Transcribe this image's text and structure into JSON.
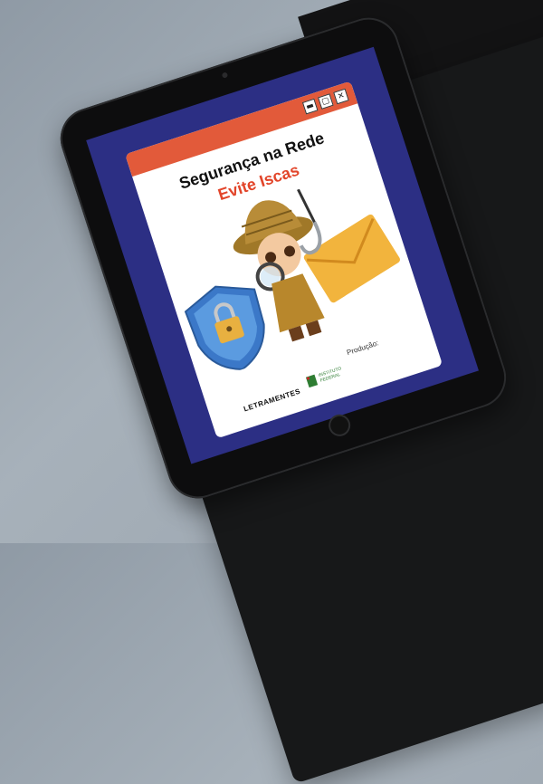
{
  "ebook": {
    "title_line1": "Segurança na Rede",
    "title_line2": "Evite Iscas",
    "production_label": "Produção:",
    "publisher": "LETRAMENTES",
    "institution": "INSTITUTO FEDERAL",
    "window_buttons": [
      "▬",
      "▢",
      "✕"
    ]
  },
  "colors": {
    "screen_bg": "#2c2f84",
    "title_bar": "#e25a3a",
    "subtitle": "#e2452a"
  },
  "icons": [
    "shield-lock-icon",
    "detective-illustration",
    "envelope-icon",
    "fishing-hook-icon"
  ]
}
